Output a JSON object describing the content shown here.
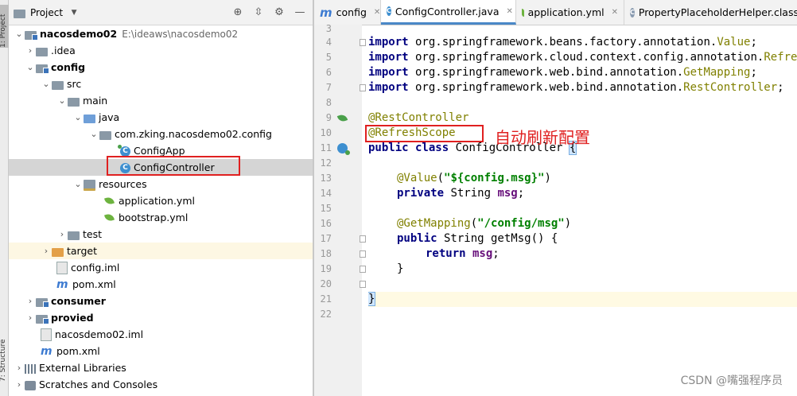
{
  "side_tabs": {
    "project": "1: Project",
    "structure": "7: Structure"
  },
  "project_panel": {
    "title": "Project",
    "tree": [
      {
        "label": "nacosdemo02",
        "path": "E:\\ideaws\\nacosdemo02",
        "bold": true
      },
      {
        "label": ".idea"
      },
      {
        "label": "config",
        "bold": true
      },
      {
        "label": "src"
      },
      {
        "label": "main"
      },
      {
        "label": "java"
      },
      {
        "label": "com.zking.nacosdemo02.config"
      },
      {
        "label": "ConfigApp"
      },
      {
        "label": "ConfigController",
        "selected": true
      },
      {
        "label": "resources"
      },
      {
        "label": "application.yml"
      },
      {
        "label": "bootstrap.yml"
      },
      {
        "label": "test"
      },
      {
        "label": "target"
      },
      {
        "label": "config.iml"
      },
      {
        "label": "pom.xml"
      },
      {
        "label": "consumer",
        "bold": true
      },
      {
        "label": "provied",
        "bold": true
      },
      {
        "label": "nacosdemo02.iml"
      },
      {
        "label": "pom.xml"
      },
      {
        "label": "External Libraries"
      },
      {
        "label": "Scratches and Consoles"
      }
    ]
  },
  "tabs": [
    {
      "label": "config"
    },
    {
      "label": "ConfigController.java",
      "active": true
    },
    {
      "label": "application.yml"
    },
    {
      "label": "PropertyPlaceholderHelper.class"
    }
  ],
  "line_numbers": [
    "3",
    "4",
    "5",
    "6",
    "7",
    "8",
    "9",
    "10",
    "11",
    "12",
    "13",
    "14",
    "15",
    "16",
    "17",
    "18",
    "19",
    "20",
    "21",
    "22"
  ],
  "code": {
    "import_kw": "import",
    "l4_pkg": " org.springframework.beans.factory.annotation.",
    "l4_cls": "Value",
    "l5_pkg": " org.springframework.cloud.context.config.annotation.",
    "l5_cls": "RefreshScope",
    "l6_pkg": " org.springframework.web.bind.annotation.",
    "l6_cls": "GetMapping",
    "l7_pkg": " org.springframework.web.bind.annotation.",
    "l7_cls": "RestController",
    "l9": "@RestController",
    "l10": "@RefreshScope",
    "l11_kw": "public class",
    "l11_name": " ConfigController ",
    "l11_brace": "{",
    "l13_ann": "@Value",
    "l13_open": "(",
    "l13_str": "\"${config.msg}\"",
    "l13_close": ")",
    "l14_kw": "private",
    "l14_type": " String ",
    "l14_fld": "msg",
    "l14_end": ";",
    "l16_ann": "@GetMapping",
    "l16_open": "(",
    "l16_str": "\"/config/msg\"",
    "l16_close": ")",
    "l17_kw": "public",
    "l17_rest": " String getMsg() {",
    "l18_kw": "return",
    "l18_fld": " msg",
    "l18_end": ";",
    "l19": "}",
    "l21": "}"
  },
  "annotation_note": "自动刷新配置",
  "watermark": "CSDN @嘴强程序员"
}
